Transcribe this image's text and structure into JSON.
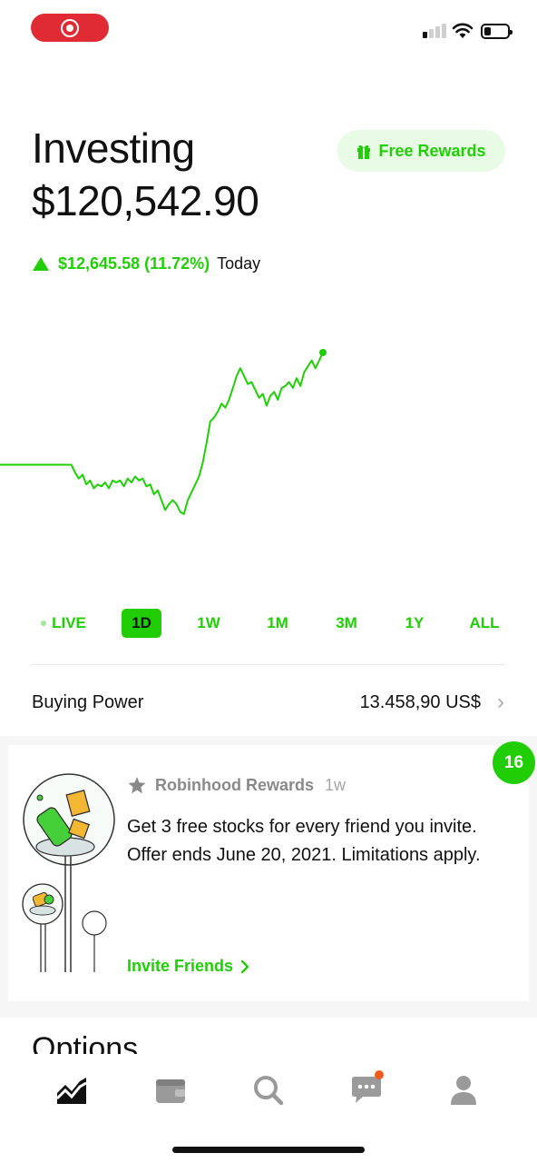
{
  "status_bar": {
    "signal_bars_on": 1,
    "signal_bars_total": 4,
    "battery_level": 0.3
  },
  "header": {
    "title": "Investing",
    "balance": "$120,542.90",
    "rewards_button": "Free Rewards"
  },
  "change": {
    "value": "$12,645.58 (11.72%)",
    "period": "Today",
    "direction": "up"
  },
  "chart_data": {
    "type": "line",
    "title": "",
    "xlabel": "",
    "ylabel": "",
    "color": "#21ce06",
    "baseline_line": true,
    "ylim": [
      0,
      100
    ],
    "values": [
      51,
      51,
      51,
      51,
      51,
      51,
      51,
      51,
      51,
      51,
      51,
      51,
      51,
      51,
      51,
      51,
      51,
      51,
      51,
      51,
      47,
      44,
      46,
      41,
      43,
      39,
      41,
      40,
      42,
      39,
      43,
      42,
      43,
      40,
      44,
      42,
      45,
      43,
      44,
      40,
      41,
      36,
      38,
      33,
      28,
      31,
      33,
      31,
      27,
      26,
      33,
      37,
      41,
      45,
      52,
      62,
      73,
      75,
      78,
      82,
      80,
      84,
      90,
      96,
      100,
      96,
      92,
      93,
      89,
      85,
      87,
      81,
      86,
      88,
      84,
      90,
      91,
      93,
      90,
      95,
      91,
      98,
      101,
      104,
      100,
      104,
      108
    ],
    "accent": "#21ce06"
  },
  "range_tabs": {
    "items": [
      "LIVE",
      "1D",
      "1W",
      "1M",
      "3M",
      "1Y",
      "ALL"
    ],
    "selected": "1D"
  },
  "buying_power": {
    "label": "Buying Power",
    "value": "13.458,90 US$"
  },
  "card": {
    "badge": "16",
    "source": "Robinhood Rewards",
    "age": "1w",
    "body": "Get 3 free stocks for every friend you invite. Offer ends June 20, 2021. Limitations apply.",
    "link": "Invite Friends"
  },
  "next_section": {
    "title": "Options"
  },
  "bottom_nav": {
    "items": [
      "chart-icon",
      "wallet-icon",
      "search-icon",
      "messages-icon",
      "account-icon"
    ],
    "selected": "chart-icon",
    "notification_on": "messages-icon"
  },
  "colors": {
    "accent": "#21ce06",
    "record": "#e02b35",
    "notification": "#f45a19"
  }
}
